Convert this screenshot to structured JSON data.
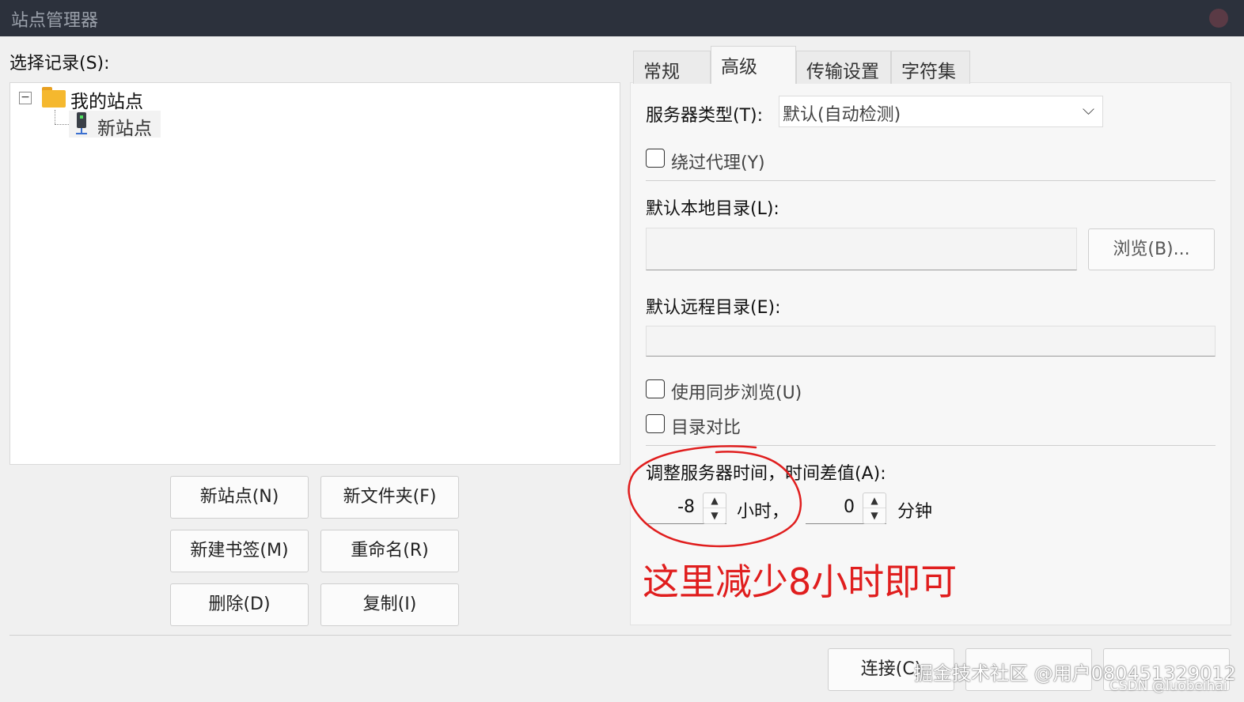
{
  "window": {
    "title": "站点管理器"
  },
  "left": {
    "select_label": "选择记录(S):",
    "tree": {
      "root": "我的站点",
      "child": "新站点"
    },
    "buttons": {
      "new_site": "新站点(N)",
      "new_folder": "新文件夹(F)",
      "new_bookmark": "新建书签(M)",
      "rename": "重命名(R)",
      "delete": "删除(D)",
      "copy": "复制(I)"
    }
  },
  "tabs": [
    "常规",
    "高级",
    "传输设置",
    "字符集"
  ],
  "active_tab": "高级",
  "advanced": {
    "server_type_label": "服务器类型(T):",
    "server_type_value": "默认(自动检测)",
    "bypass_proxy": "绕过代理(Y)",
    "local_dir_label": "默认本地目录(L):",
    "local_dir_value": "",
    "browse_button": "浏览(B)...",
    "remote_dir_label": "默认远程目录(E):",
    "remote_dir_value": "",
    "sync_browse": "使用同步浏览(U)",
    "dir_compare": "目录对比",
    "time_adjust_label": "调整服务器时间，时间差值(A):",
    "hours_value": "-8",
    "hours_unit": "小时，",
    "minutes_value": "0",
    "minutes_unit": "分钟"
  },
  "annotation": {
    "note": "这里减少8小时即可",
    "color": "#e01e1e"
  },
  "footer": {
    "connect_button": "连接(C)"
  },
  "watermarks": {
    "juejin": "掘金技术社区 @用户080451329012",
    "csdn": "CSDN @luobeihai"
  },
  "colors": {
    "titlebar": "#2c313c",
    "folder": "#f5b82e",
    "annotation": "#e01e1e"
  }
}
